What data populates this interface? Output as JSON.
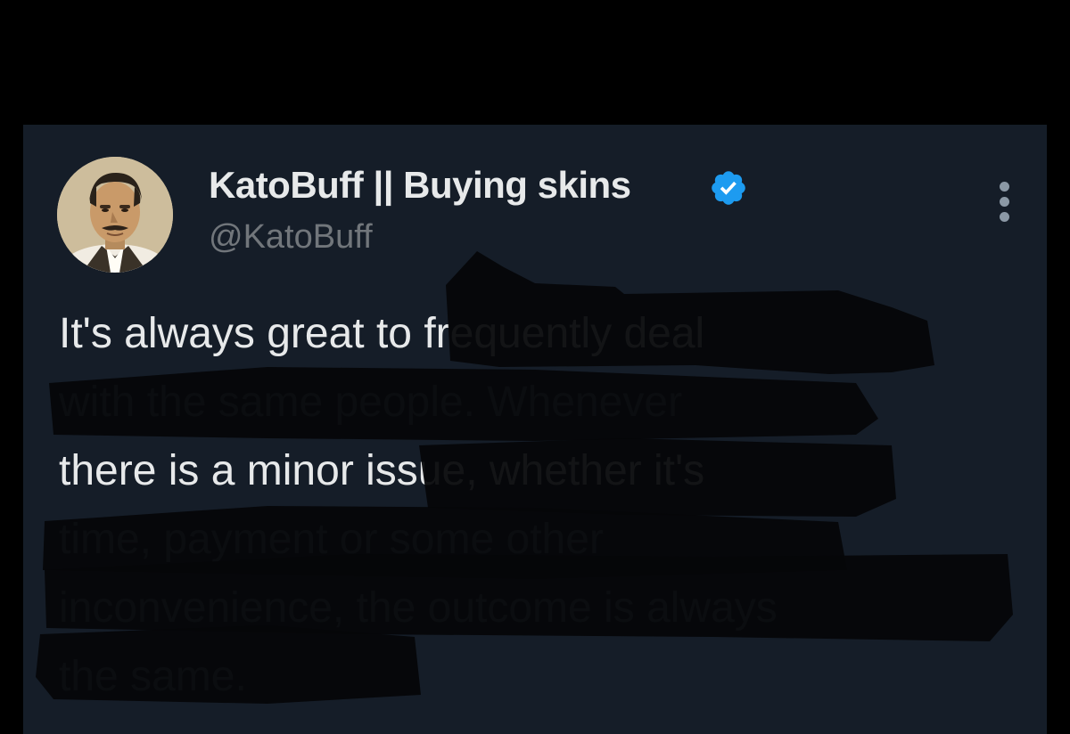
{
  "tweet": {
    "author": {
      "display_name": "KatoBuff || Buying skins",
      "handle": "@KatoBuff",
      "verified": true,
      "avatar_icon": "profile-photo"
    },
    "more_icon": "more-vertical-icon",
    "text_lines": [
      "It's always great to frequently deal",
      "with the same people. Whenever",
      "there is a minor issue, whether it's",
      "time, payment or some other",
      "inconvenience, the outcome is always",
      "the same."
    ]
  },
  "colors": {
    "background": "#000000",
    "card": "#151d28",
    "text_primary": "#e7e9ea",
    "text_secondary": "#71767b",
    "verified_badge": "#1d9bf0",
    "redaction": "#050608"
  }
}
